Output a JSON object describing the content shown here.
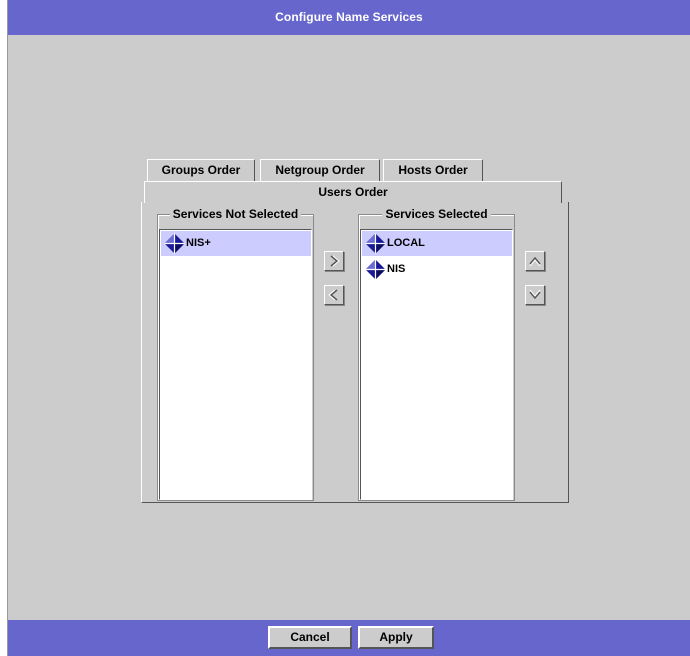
{
  "window": {
    "title": "Configure Name Services"
  },
  "tabs": {
    "groups": "Groups Order",
    "netgroup": "Netgroup Order",
    "hosts": "Hosts Order",
    "users": "Users Order"
  },
  "not_selected": {
    "title": "Services Not Selected",
    "items": [
      {
        "label": "NIS+",
        "icon": "name-service-diamond-icon",
        "selected": true
      }
    ]
  },
  "selected": {
    "title": "Services Selected",
    "items": [
      {
        "label": "LOCAL",
        "icon": "name-service-diamond-icon",
        "selected": true
      },
      {
        "label": "NIS",
        "icon": "name-service-diamond-icon",
        "selected": false
      }
    ]
  },
  "buttons": {
    "cancel": "Cancel",
    "apply": "Apply"
  },
  "colors": {
    "titlebar": "#6666cc",
    "background": "#cccccc",
    "selection": "#ccccff",
    "icon_blue": "#1a1a99"
  }
}
